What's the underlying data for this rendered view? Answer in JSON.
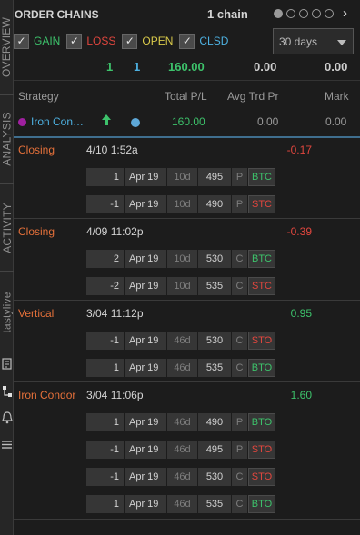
{
  "sidebar": {
    "tabs": [
      "OVERVIEW",
      "ANALYSIS",
      "ACTIVITY",
      "tastylive"
    ]
  },
  "header": {
    "title": "ORDER CHAINS",
    "chain_count": "1 chain",
    "page_dots": 5,
    "active_dot": 1
  },
  "filters": {
    "gain": "GAIN",
    "loss": "LOSS",
    "open": "OPEN",
    "clsd": "CLSD",
    "period": "30 days"
  },
  "totals": {
    "a": "1",
    "b": "1",
    "pl": "160.00",
    "avg": "0.00",
    "mark": "0.00"
  },
  "columns": {
    "strategy": "Strategy",
    "total_pl": "Total P/L",
    "avg_trd_pr": "Avg Trd Pr",
    "mark": "Mark"
  },
  "summary": {
    "name": "Iron Con…",
    "pl": "160.00",
    "avg": "0.00",
    "mark": "0.00"
  },
  "groups": [
    {
      "type": "Closing",
      "date": "4/10 1:52a",
      "pl": "-0.17",
      "legs": [
        {
          "qty": "1",
          "exp": "Apr 19",
          "days": "10d",
          "strike": "495",
          "pc": "P",
          "act": "BTC"
        },
        {
          "qty": "-1",
          "exp": "Apr 19",
          "days": "10d",
          "strike": "490",
          "pc": "P",
          "act": "STC"
        }
      ]
    },
    {
      "type": "Closing",
      "date": "4/09 11:02p",
      "pl": "-0.39",
      "legs": [
        {
          "qty": "2",
          "exp": "Apr 19",
          "days": "10d",
          "strike": "530",
          "pc": "C",
          "act": "BTC"
        },
        {
          "qty": "-2",
          "exp": "Apr 19",
          "days": "10d",
          "strike": "535",
          "pc": "C",
          "act": "STC"
        }
      ]
    },
    {
      "type": "Vertical",
      "date": "3/04 11:12p",
      "pl": "0.95",
      "legs": [
        {
          "qty": "-1",
          "exp": "Apr 19",
          "days": "46d",
          "strike": "530",
          "pc": "C",
          "act": "STO"
        },
        {
          "qty": "1",
          "exp": "Apr 19",
          "days": "46d",
          "strike": "535",
          "pc": "C",
          "act": "BTO"
        }
      ]
    },
    {
      "type": "Iron Condor",
      "date": "3/04 11:06p",
      "pl": "1.60",
      "legs": [
        {
          "qty": "1",
          "exp": "Apr 19",
          "days": "46d",
          "strike": "490",
          "pc": "P",
          "act": "BTO"
        },
        {
          "qty": "-1",
          "exp": "Apr 19",
          "days": "46d",
          "strike": "495",
          "pc": "P",
          "act": "STO"
        },
        {
          "qty": "-1",
          "exp": "Apr 19",
          "days": "46d",
          "strike": "530",
          "pc": "C",
          "act": "STO"
        },
        {
          "qty": "1",
          "exp": "Apr 19",
          "days": "46d",
          "strike": "535",
          "pc": "C",
          "act": "BTO"
        }
      ]
    }
  ]
}
